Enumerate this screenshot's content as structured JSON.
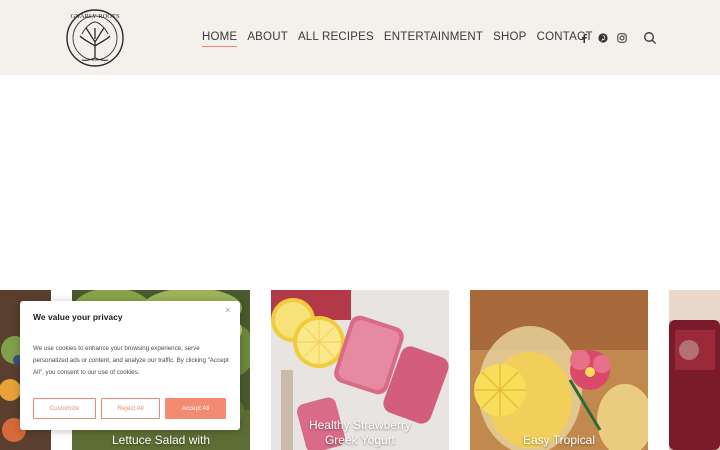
{
  "site": {
    "logo_text": "GNARLY ROOTS"
  },
  "nav": {
    "items": [
      {
        "label": "HOME",
        "active": true
      },
      {
        "label": "ABOUT",
        "active": false
      },
      {
        "label": "ALL RECIPES",
        "active": false
      },
      {
        "label": "ENTERTAINMENT",
        "active": false
      },
      {
        "label": "SHOP",
        "active": false
      },
      {
        "label": "CONTACT",
        "active": false
      }
    ]
  },
  "social": [
    "facebook-icon",
    "pinterest-icon",
    "instagram-icon"
  ],
  "cards": [
    {
      "title": ""
    },
    {
      "title": "Lettuce Salad with"
    },
    {
      "title_line1": "Healthy Strawberry",
      "title_line2": "Greek Yogurt"
    },
    {
      "title": "Easy Tropical"
    },
    {
      "title": ""
    }
  ],
  "cookie": {
    "title": "We value your privacy",
    "close": "×",
    "text": "We use cookies to enhance your browsing experience, serve personalized ads or content, and analyze our traffic. By clicking \"Accept All\", you consent to our use of cookies.",
    "buttons": {
      "customize": "Customize",
      "reject": "Reject All",
      "accept": "Accept All"
    }
  },
  "colors": {
    "header_bg": "#f4f0ec",
    "accent": "#e98c72",
    "accept_bg": "#f28b72"
  }
}
